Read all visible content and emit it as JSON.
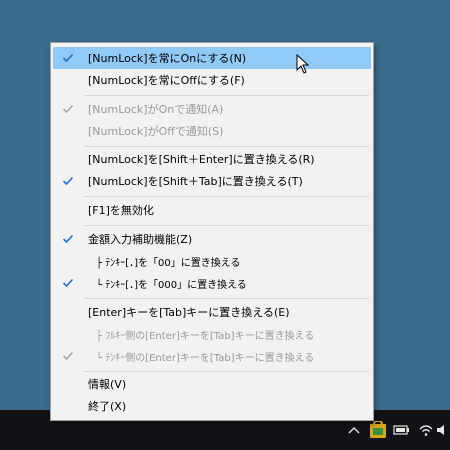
{
  "menu": {
    "items": [
      {
        "label": "[NumLock]を常にOnにする(N)",
        "checked": true,
        "disabled": false
      },
      {
        "label": "[NumLock]を常にOffにする(F)",
        "checked": false,
        "disabled": false
      },
      {
        "label": "[NumLock]がOnで通知(A)",
        "checked": true,
        "disabled": true
      },
      {
        "label": "[NumLock]がOffで通知(S)",
        "checked": false,
        "disabled": true
      },
      {
        "label": "[NumLock]を[Shift＋Enter]に置き換える(R)",
        "checked": false,
        "disabled": false
      },
      {
        "label": "[NumLock]を[Shift＋Tab]に置き換える(T)",
        "checked": true,
        "disabled": false
      },
      {
        "label": "[F1]を無効化",
        "checked": false,
        "disabled": false
      },
      {
        "label": "金額入力補助機能(Z)",
        "checked": true,
        "disabled": false
      },
      {
        "label": "├ ﾃﾝｷｰ[．]を「00」に置き換える",
        "checked": false,
        "disabled": false
      },
      {
        "label": "└ ﾃﾝｷｰ[．]を「000」に置き換える",
        "checked": true,
        "disabled": false
      },
      {
        "label": "[Enter]キーを[Tab]キーに置き換える(E)",
        "checked": false,
        "disabled": false
      },
      {
        "label": "├ ﾌﾙｷｰ側の[Enter]キーを[Tab]キーに置き換える",
        "checked": false,
        "disabled": true
      },
      {
        "label": "└ ﾃﾝｷｰ側の[Enter]キーを[Tab]キーに置き換える",
        "checked": true,
        "disabled": true
      },
      {
        "label": "情報(V)",
        "checked": false,
        "disabled": false
      },
      {
        "label": "終了(X)",
        "checked": false,
        "disabled": false
      }
    ],
    "hovered_index": 0
  },
  "colors": {
    "hover": "#91c9f7",
    "check": "#1f6fd1",
    "check_disabled": "#a9a9a9",
    "disabled_text": "#9a9a9a"
  },
  "taskbar": {
    "tray_icons": [
      "chevron-up-icon",
      "numlock-app-icon",
      "battery-icon",
      "wifi-icon",
      "volume-icon"
    ]
  }
}
